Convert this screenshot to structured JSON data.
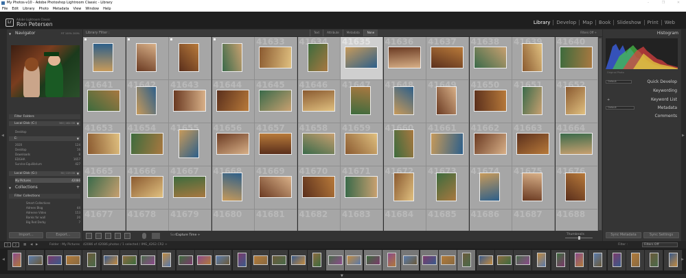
{
  "window": {
    "title": "My Photos-v10 - Adobe Photoshop Lightroom Classic - Library",
    "minimize": "–",
    "maximize": "❐",
    "close": "✕"
  },
  "menu": [
    "File",
    "Edit",
    "Library",
    "Photo",
    "Metadata",
    "View",
    "Window",
    "Help"
  ],
  "identity": {
    "logo": "Lr",
    "small": "Adobe Lightroom Classic",
    "name": "Ron Petersen"
  },
  "modules": [
    {
      "label": "Library",
      "active": true
    },
    {
      "label": "Develop",
      "active": false
    },
    {
      "label": "Map",
      "active": false
    },
    {
      "label": "Book",
      "active": false
    },
    {
      "label": "Slideshow",
      "active": false
    },
    {
      "label": "Print",
      "active": false
    },
    {
      "label": "Web",
      "active": false
    }
  ],
  "navigator": {
    "title": "Navigator",
    "zoom": "FIT   100%   200%"
  },
  "folders": {
    "filter": "Filter Folders",
    "disk_c": {
      "label": "Local Disk (C:)",
      "info": "360 / 464 GB"
    },
    "desktop": "Desktop",
    "disk_e_label": "E:",
    "items": [
      {
        "name": "2020",
        "count": "124"
      },
      {
        "name": "Desktop",
        "count": "16"
      },
      {
        "name": "Downloads",
        "count": "8"
      },
      {
        "name": "EDGHA",
        "count": "1657"
      },
      {
        "name": "Sunrise Equilibrium",
        "count": "427"
      }
    ],
    "disk_g": {
      "label": "Local Disk (G:)",
      "info": "36 / 119 GB"
    },
    "mypictures": {
      "name": "My Pictures",
      "count": "42086"
    }
  },
  "collections": {
    "title": "Collections",
    "filter": "Filter Collections",
    "items": [
      {
        "name": "Smart Collections",
        "count": ""
      },
      {
        "name": "Adreen Blog",
        "count": "44"
      },
      {
        "name": "Adreene Video",
        "count": "153"
      },
      {
        "name": "Banks for wall",
        "count": "20"
      },
      {
        "name": "Big Red Derby",
        "count": "7"
      }
    ]
  },
  "library_filter": {
    "label": "Library Filter :",
    "tabs": [
      "Text",
      "Attribute",
      "Metadata",
      "None"
    ],
    "active_tab": "None",
    "filters_off": "Filters Off ÷"
  },
  "grid": {
    "rows": [
      [
        "",
        "",
        "",
        "",
        "41633",
        "41634",
        "41635",
        "41636",
        "41637",
        "41638",
        "41639",
        "41640"
      ],
      [
        "41641",
        "41642",
        "41643",
        "41644",
        "41645",
        "41646",
        "41647",
        "41648",
        "41649",
        "41650",
        "41651",
        "41652"
      ],
      [
        "41653",
        "41654",
        "41655",
        "41656",
        "41657",
        "41658",
        "41659",
        "41660",
        "41661",
        "41662",
        "41663",
        "41664"
      ],
      [
        "41665",
        "41666",
        "41667",
        "41668",
        "41669",
        "41670",
        "41671",
        "41672",
        "41673",
        "41674",
        "41675",
        "41676"
      ],
      [
        "41677",
        "41678",
        "41679",
        "41680",
        "41681",
        "41682",
        "41683",
        "41684",
        "41685",
        "41686",
        "41687",
        "41688"
      ]
    ],
    "selected": "41635"
  },
  "toolbar": {
    "sort_label": "Sort:",
    "sort_value": "Capture Time ÷",
    "thumbnails": "Thumbnails"
  },
  "right": {
    "histogram": "Histogram",
    "histo_info": "ISO 3200   24 mm   f/2.8   1/160 sec",
    "original_photo": "Original Photo",
    "quick_develop": "Quick Develop",
    "keywording": "Keywording",
    "keyword_list": "Keyword List",
    "metadata": "Metadata",
    "comments": "Comments",
    "saved_preset": "Default",
    "sync_metadata": "Sync Metadata",
    "sync_settings": "Sync Settings"
  },
  "left_buttons": {
    "import": "Import...",
    "export": "Export..."
  },
  "status": {
    "page1": "1",
    "page2": "2",
    "source": "Folder : My Pictures",
    "count": "42086 of 42086 photos / 1 selected / IMG_4262.CR2 ÷",
    "filter_label": "Filter :",
    "filter_value": "Filters Off"
  },
  "colors": {
    "accent": "#cfcfcf",
    "panel": "#353535",
    "grid_bg": "#a6a6a6"
  }
}
